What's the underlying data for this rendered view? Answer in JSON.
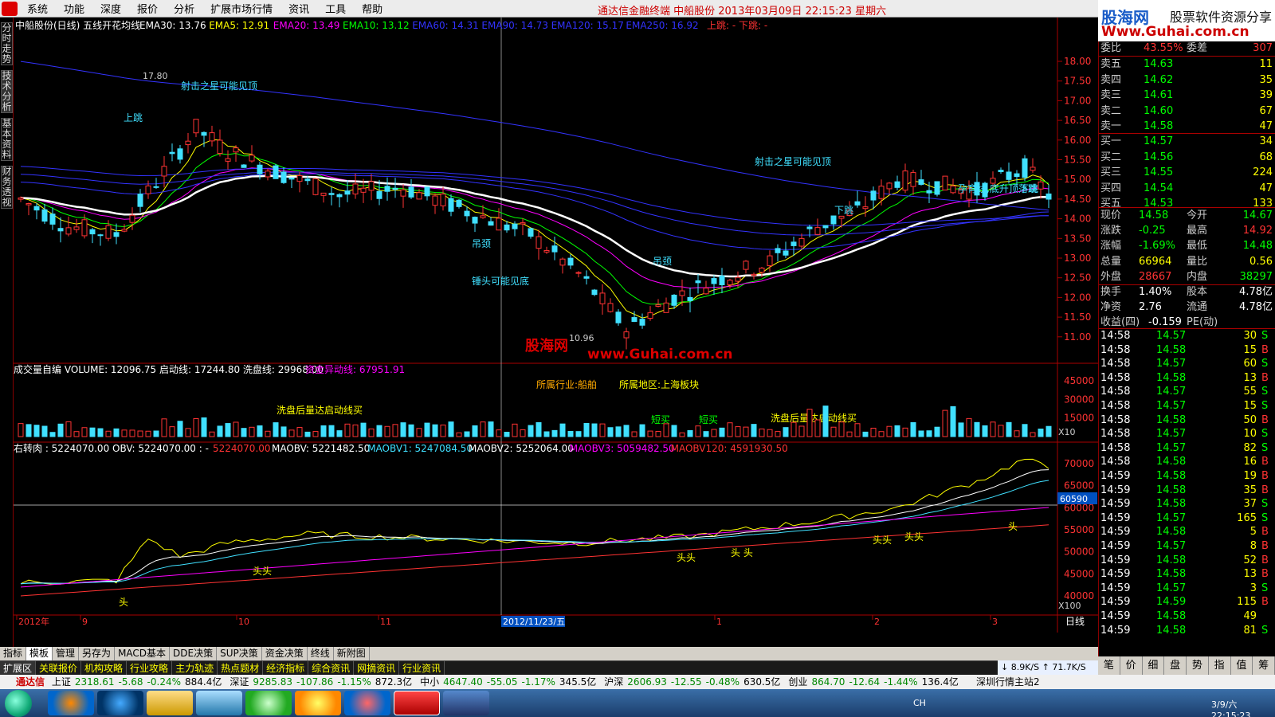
{
  "menu": {
    "items": [
      "系统",
      "功能",
      "深度",
      "报价",
      "分析",
      "扩展市场行情",
      "资讯",
      "工具",
      "帮助"
    ],
    "window_title": "通达信金融终端   中船股份  2013年03月09日  22:15:23  星期六"
  },
  "brand": {
    "line1a": "股海网",
    "line1b": "股票软件资源分享",
    "line2": "Www.Guhai.com.cn"
  },
  "left_tabs": [
    "分时走势",
    "技术分析",
    "基本资料",
    "财务透视"
  ],
  "main_panel": {
    "header_name": "中船股份(日线) 五线开花均线",
    "ema": [
      {
        "label": "EMA30: 13.76",
        "color": "#ffffff"
      },
      {
        "label": "EMA5: 12.91",
        "color": "#ffff00"
      },
      {
        "label": "EMA20: 13.49",
        "color": "#ff00ff"
      },
      {
        "label": "EMA10: 13.12",
        "color": "#00ff00"
      },
      {
        "label": "EMA60: 14.31",
        "color": "#3333ff"
      },
      {
        "label": "EMA90: 14.73",
        "color": "#3333ff"
      },
      {
        "label": "EMA120: 15.17",
        "color": "#3333ff"
      },
      {
        "label": "EMA250: 16.92",
        "color": "#3333ff"
      }
    ],
    "extra": "上跳: -  下跳: -",
    "y_ticks": [
      "18.00",
      "17.50",
      "17.00",
      "16.50",
      "16.00",
      "15.50",
      "15.00",
      "14.50",
      "14.00",
      "13.50",
      "13.00",
      "12.50",
      "12.00",
      "11.50",
      "11.00"
    ],
    "high_mark": "17.80",
    "low_mark": "10.96",
    "annotations": [
      {
        "text": "射击之星可能见顶",
        "color": "#40e0ff"
      },
      {
        "text": "射击之星可能见顶",
        "color": "#40e0ff"
      },
      {
        "text": "吊颈",
        "color": "#40e0ff"
      },
      {
        "text": "锤头可能见底",
        "color": "#40e0ff"
      },
      {
        "text": "吊颈",
        "color": "#40e0ff"
      },
      {
        "text": "孕育线,底升顶落跳",
        "color": "#40e0ff"
      },
      {
        "text": "上跳",
        "color": "#40e0ff"
      },
      {
        "text": "下跳",
        "color": "#40e0ff"
      },
      {
        "text": "下跳",
        "color": "#40e0ff"
      }
    ],
    "watermark1": "股海网",
    "watermark2": "www.Guhai.com.cn"
  },
  "volume_panel": {
    "header": "成交量自编  VOLUME: 12096.75  启动线: 17244.80  洗盘线: 29968.00",
    "header2": "资金异动线: 67951.91",
    "industry": "所属行业:船舶",
    "region": "所属地区:上海板块",
    "note1": "洗盘后量达启动线买",
    "note2": "洗盘后量达启动线买",
    "short_buy": "短买",
    "y_ticks": [
      "45000",
      "30000",
      "15000"
    ],
    "unit": "X10"
  },
  "obv_panel": {
    "header": "右转肉 : 5224070.00  OBV: 5224070.00 : -",
    "header_vals": [
      {
        "label": "5224070.00",
        "color": "#ff3333"
      },
      {
        "label": "MAOBV: 5221482.50",
        "color": "#ffffff"
      },
      {
        "label": "MAOBV1: 5247084.50",
        "color": "#40e0ff"
      },
      {
        "label": "MAOBV2: 5252064.00",
        "color": "#ffffff"
      },
      {
        "label": "MAOBV3: 5059482.50",
        "color": "#ff00ff"
      },
      {
        "label": "MAOBV120: 4591930.50",
        "color": "#ff3333"
      }
    ],
    "y_ticks": [
      "70000",
      "65000",
      "60000",
      "55000",
      "50000",
      "45000",
      "40000"
    ],
    "cursor_value": "60590",
    "unit": "X100",
    "head_marks": [
      "头",
      "头头",
      "头头",
      "头 头",
      "头头",
      "头头",
      "头"
    ]
  },
  "x_axis": {
    "labels": [
      "2012年",
      "9",
      "10",
      "11",
      "1",
      "2",
      "3"
    ],
    "cursor_date": "2012/11/23/五",
    "right_label": "日线"
  },
  "quote": {
    "wei": {
      "label1": "委比",
      "val1": "43.55%",
      "label2": "委差",
      "val2": "307"
    },
    "sells": [
      {
        "name": "卖五",
        "price": "14.63",
        "vol": "11"
      },
      {
        "name": "卖四",
        "price": "14.62",
        "vol": "35"
      },
      {
        "name": "卖三",
        "price": "14.61",
        "vol": "39"
      },
      {
        "name": "卖二",
        "price": "14.60",
        "vol": "67"
      },
      {
        "name": "卖一",
        "price": "14.58",
        "vol": "47"
      }
    ],
    "buys": [
      {
        "name": "买一",
        "price": "14.57",
        "vol": "34"
      },
      {
        "name": "买二",
        "price": "14.56",
        "vol": "68"
      },
      {
        "name": "买三",
        "price": "14.55",
        "vol": "224"
      },
      {
        "name": "买四",
        "price": "14.54",
        "vol": "47"
      },
      {
        "name": "买五",
        "price": "14.53",
        "vol": "133"
      }
    ],
    "stats": [
      {
        "l1": "现价",
        "v1": "14.58",
        "c1": "#00ff00",
        "l2": "今开",
        "v2": "14.67",
        "c2": "#00ff00"
      },
      {
        "l1": "涨跌",
        "v1": "-0.25",
        "c1": "#00ff00",
        "l2": "最高",
        "v2": "14.92",
        "c2": "#ff3333"
      },
      {
        "l1": "涨幅",
        "v1": "-1.69%",
        "c1": "#00ff00",
        "l2": "最低",
        "v2": "14.48",
        "c2": "#00ff00"
      },
      {
        "l1": "总量",
        "v1": "66964",
        "c1": "#ffff00",
        "l2": "量比",
        "v2": "0.56",
        "c2": "#ffff00"
      },
      {
        "l1": "外盘",
        "v1": "28667",
        "c1": "#ff3333",
        "l2": "内盘",
        "v2": "38297",
        "c2": "#00ff00"
      },
      {
        "l1": "换手",
        "v1": "1.40%",
        "c1": "#ffffff",
        "l2": "股本",
        "v2": "4.78亿",
        "c2": "#ffffff"
      },
      {
        "l1": "净资",
        "v1": "2.76",
        "c1": "#ffffff",
        "l2": "流通",
        "v2": "4.78亿",
        "c2": "#ffffff"
      },
      {
        "l1": "收益(四)",
        "v1": "-0.159",
        "c1": "#ffffff",
        "l2": "PE(动)",
        "v2": "",
        "c2": "#ffffff"
      }
    ],
    "ticks": [
      {
        "t": "14:58",
        "p": "14.57",
        "v": "30",
        "s": "S"
      },
      {
        "t": "14:58",
        "p": "14.58",
        "v": "15",
        "s": "B"
      },
      {
        "t": "14:58",
        "p": "14.57",
        "v": "60",
        "s": "S"
      },
      {
        "t": "14:58",
        "p": "14.58",
        "v": "13",
        "s": "B"
      },
      {
        "t": "14:58",
        "p": "14.57",
        "v": "55",
        "s": "S"
      },
      {
        "t": "14:58",
        "p": "14.57",
        "v": "15",
        "s": "S"
      },
      {
        "t": "14:58",
        "p": "14.58",
        "v": "50",
        "s": "B"
      },
      {
        "t": "14:58",
        "p": "14.57",
        "v": "10",
        "s": "S"
      },
      {
        "t": "14:58",
        "p": "14.57",
        "v": "82",
        "s": "S"
      },
      {
        "t": "14:58",
        "p": "14.58",
        "v": "16",
        "s": "B"
      },
      {
        "t": "14:59",
        "p": "14.58",
        "v": "19",
        "s": "B"
      },
      {
        "t": "14:59",
        "p": "14.58",
        "v": "35",
        "s": "B"
      },
      {
        "t": "14:59",
        "p": "14.58",
        "v": "37",
        "s": "S"
      },
      {
        "t": "14:59",
        "p": "14.57",
        "v": "165",
        "s": "S"
      },
      {
        "t": "14:59",
        "p": "14.58",
        "v": "5",
        "s": "B"
      },
      {
        "t": "14:59",
        "p": "14.57",
        "v": "8",
        "s": "B"
      },
      {
        "t": "14:59",
        "p": "14.58",
        "v": "52",
        "s": "B"
      },
      {
        "t": "14:59",
        "p": "14.58",
        "v": "13",
        "s": "B"
      },
      {
        "t": "14:59",
        "p": "14.57",
        "v": "3",
        "s": "S"
      },
      {
        "t": "14:59",
        "p": "14.59",
        "v": "115",
        "s": "B"
      },
      {
        "t": "14:59",
        "p": "14.58",
        "v": "49",
        "s": ""
      },
      {
        "t": "14:59",
        "p": "14.58",
        "v": "81",
        "s": "S"
      }
    ],
    "tabs": [
      "笔",
      "价",
      "细",
      "盘",
      "势",
      "指",
      "值",
      "筹"
    ]
  },
  "bottom_tabs1": [
    "指标",
    "模板",
    "管理",
    "另存为",
    "MACD基本",
    "DDE决策",
    "SUP决策",
    "资金决策",
    "终线",
    "新附图"
  ],
  "bottom_tabs2": [
    "扩展区",
    "关联报价",
    "机构攻略",
    "行业攻略",
    "主力轨迹",
    "热点题材",
    "经济指标",
    "综合资讯",
    "网摘资讯",
    "行业资讯"
  ],
  "netspeed": "↓ 8.9K/S  ↑ 71.7K/S",
  "ticker": {
    "app": "通达信",
    "items": [
      {
        "name": "上证",
        "val": "2318.61",
        "chg": "-5.68",
        "pct": "-0.24%",
        "amt": "884.4亿"
      },
      {
        "name": "深证",
        "val": "9285.83",
        "chg": "-107.86",
        "pct": "-1.15%",
        "amt": "872.3亿"
      },
      {
        "name": "中小",
        "val": "4647.40",
        "chg": "-55.05",
        "pct": "-1.17%",
        "amt": "345.5亿"
      },
      {
        "name": "沪深",
        "val": "2606.93",
        "chg": "-12.55",
        "pct": "-0.48%",
        "amt": "630.5亿"
      },
      {
        "name": "创业",
        "val": "864.70",
        "chg": "-12.64",
        "pct": "-1.44%",
        "amt": "136.4亿"
      }
    ],
    "right_text": "深圳行情主站2"
  },
  "taskbar": {
    "clock": "3/9/六 22:15:23",
    "lang": "CH"
  }
}
